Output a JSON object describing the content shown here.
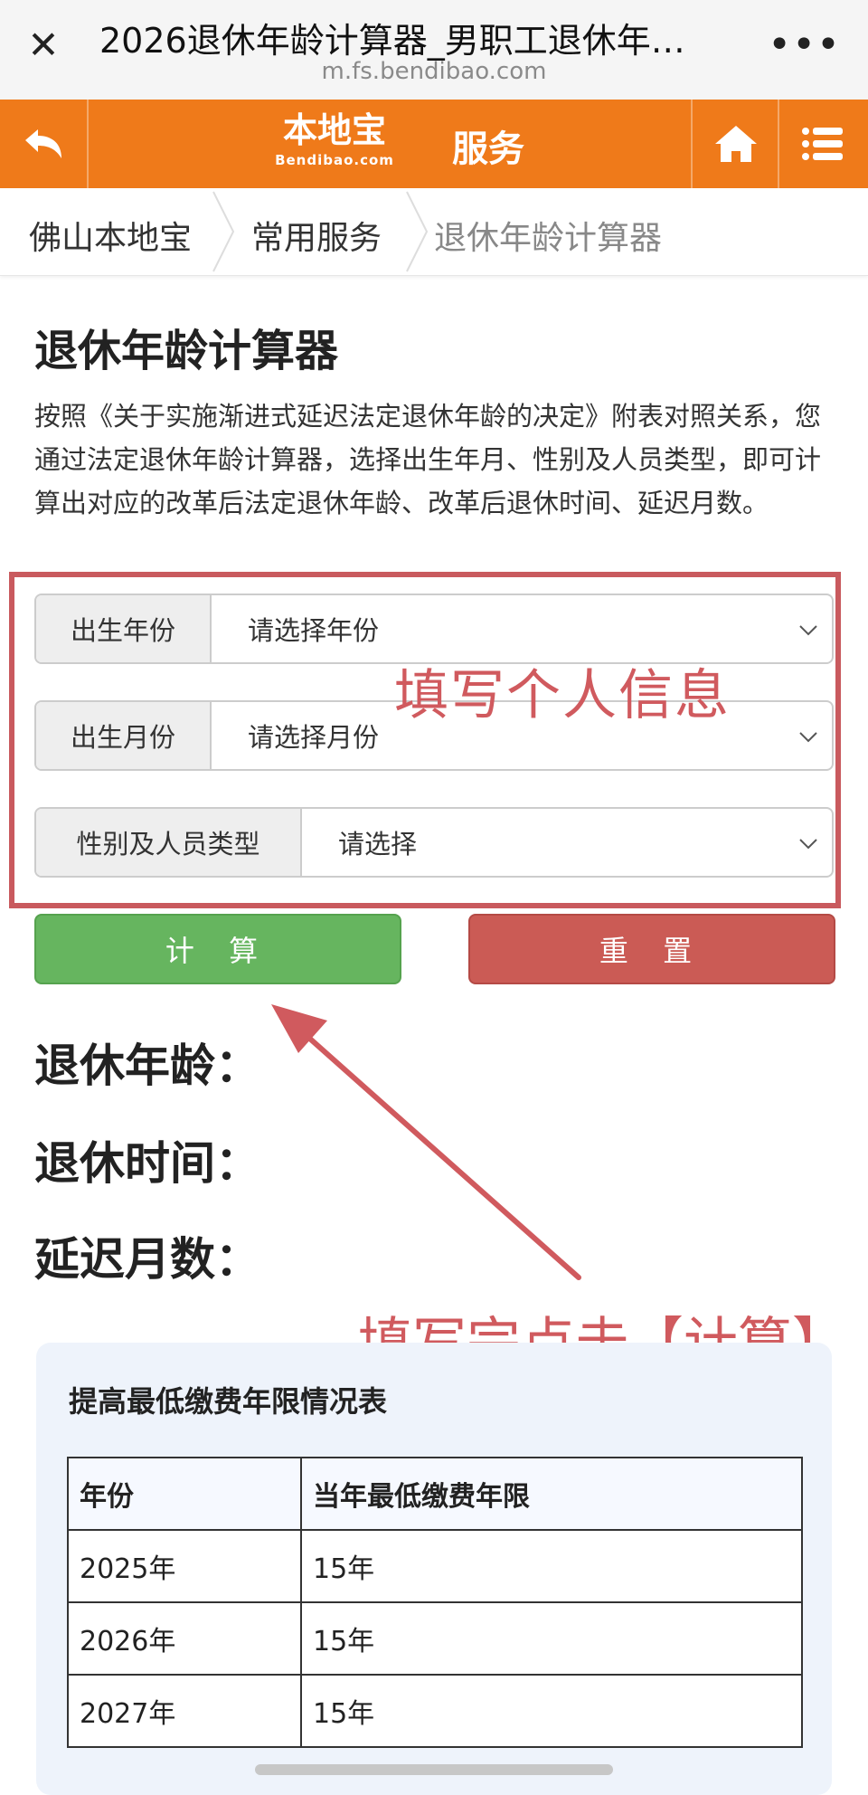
{
  "browser": {
    "title": "2026退休年龄计算器_男职工退休年…",
    "url": "m.fs.bendibao.com",
    "close_icon": "close-icon",
    "more_icon": "more-dots-icon"
  },
  "header": {
    "logo_cn": "本地宝",
    "logo_en": "Bendibao.com",
    "service_label": "服务",
    "back_icon": "back-arrow-icon",
    "home_icon": "home-icon",
    "menu_icon": "menu-icon",
    "accent_color": "#ef7a1a"
  },
  "breadcrumb": {
    "items": [
      "佛山本地宝",
      "常用服务",
      "退休年龄计算器"
    ]
  },
  "page": {
    "title": "退休年龄计算器",
    "description": "按照《关于实施渐进式延迟法定退休年龄的决定》附表对照关系，您通过法定退休年龄计算器，选择出生年月、性别及人员类型，即可计算出对应的改革后法定退休年龄、改革后退休时间、延迟月数。"
  },
  "form": {
    "fields": [
      {
        "label": "出生年份",
        "placeholder": "请选择年份"
      },
      {
        "label": "出生月份",
        "placeholder": "请选择月份"
      },
      {
        "label": "性别及人员类型",
        "placeholder": "请选择"
      }
    ],
    "calc_label": "计 算",
    "reset_label": "重 置",
    "calc_color": "#66b55f",
    "reset_color": "#cb5b55"
  },
  "results": {
    "retire_age_label": "退休年龄：",
    "retire_time_label": "退休时间：",
    "delay_months_label": "延迟月数："
  },
  "annotations": {
    "info_text": "填写个人信息",
    "click_text": "填写完点击【计算】",
    "color": "#d05a5e"
  },
  "table": {
    "title": "提高最低缴费年限情况表",
    "headers": [
      "年份",
      "当年最低缴费年限"
    ],
    "rows": [
      [
        "2025年",
        "15年"
      ],
      [
        "2026年",
        "15年"
      ],
      [
        "2027年",
        "15年"
      ]
    ]
  }
}
